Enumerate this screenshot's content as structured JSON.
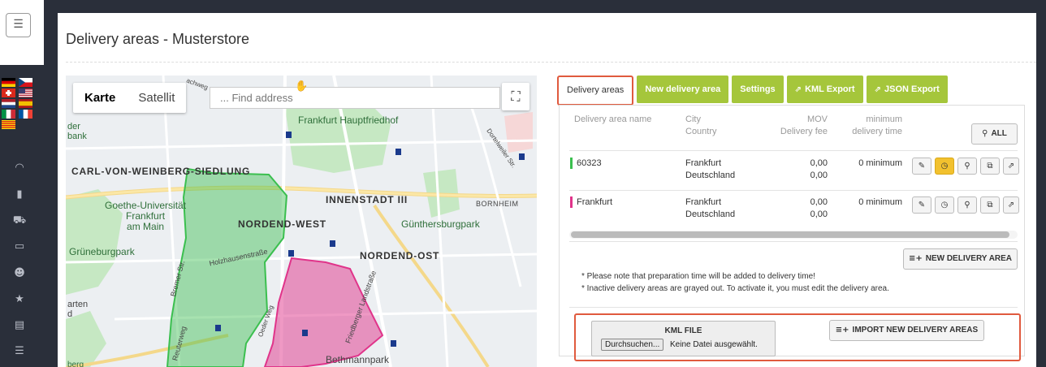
{
  "sidebar": {
    "menu_icon": "hamburger-icon",
    "flags": [
      "de",
      "cz",
      "ch",
      "us",
      "nl",
      "es",
      "it",
      "fr",
      "catalonia"
    ],
    "nav_icons": [
      "dashboard-icon",
      "bar-chart-icon",
      "cart-icon",
      "monitor-icon",
      "user-plus-icon",
      "star-icon",
      "archive-icon",
      "list-icon"
    ]
  },
  "page": {
    "title": "Delivery areas - Musterstore"
  },
  "map": {
    "type_buttons": [
      "Karte",
      "Satellit"
    ],
    "search_placeholder": "... Find address",
    "labels": {
      "carl": "CARL-VON-WEINBERG-SIEDLUNG",
      "innenstadt": "INNENSTADT III",
      "nordend_west": "NORDEND-WEST",
      "nordend_ost": "NORDEND-OST",
      "bornheim": "BORNHEIM",
      "hauptfriedhof": "Frankfurt Hauptfriedhof",
      "goethe": "Goethe-Universität\nFrankfurt\nam Main",
      "gruneburg": "Grüneburgpark",
      "guenthersburg": "Günthersburgpark",
      "holzhausen": "Holzhausenstraße",
      "bethmann": "Bethmannpark",
      "dortelweiler": "Dortelweiler Str.",
      "friedberger": "Friedberger Landstraße",
      "eschersheimer": "Oeder Weg",
      "bremer": "Bremer Str.",
      "reuter": "Reuterweg",
      "bank": "der\nbank",
      "garten": "arten\nd",
      "achweg": "achweg",
      "berg": "berg"
    }
  },
  "tabs": [
    {
      "label": "Delivery areas",
      "active": true
    },
    {
      "label": "New delivery area",
      "active": false
    },
    {
      "label": "Settings",
      "active": false
    },
    {
      "label": "KML Export",
      "active": false,
      "icon": "export-icon"
    },
    {
      "label": "JSON Export",
      "active": false,
      "icon": "export-icon"
    }
  ],
  "table": {
    "headers": {
      "name": "Delivery area name",
      "city": "City",
      "country": "Country",
      "mov": "MOV",
      "fee": "Delivery fee",
      "min1": "minimum",
      "min2": "delivery time"
    },
    "all_button": "ALL",
    "rows": [
      {
        "name": "60323",
        "color": "#3bbf4f",
        "city": "Frankfurt",
        "country": "Deutschland",
        "mov": "0,00",
        "fee": "0,00",
        "time": "0 minimum",
        "history_active": true
      },
      {
        "name": "Frankfurt",
        "color": "#e0348a",
        "city": "Frankfurt",
        "country": "Deutschland",
        "mov": "0,00",
        "fee": "0,00",
        "time": "0 minimum",
        "history_active": false
      }
    ],
    "action_icons": [
      "edit-icon",
      "history-icon",
      "search-icon",
      "copy-icon",
      "share-icon"
    ]
  },
  "new_area_button": "NEW DELIVERY AREA",
  "notes": [
    "* Please note that preparation time will be added to delivery time!",
    "* Inactive delivery areas are grayed out. To activate it, you must edit the delivery area."
  ],
  "import": {
    "kml_label": "KML FILE",
    "browse_label": "Durchsuchen...",
    "no_file": "Keine Datei ausgewählt.",
    "import_button": "IMPORT NEW DELIVERY AREAS"
  },
  "colors": {
    "tab_green": "#a5c63b",
    "highlight_red": "#e05a3e",
    "area_green": "#3bbf4f",
    "area_pink": "#e0348a",
    "history_yellow": "#f2c12e"
  }
}
